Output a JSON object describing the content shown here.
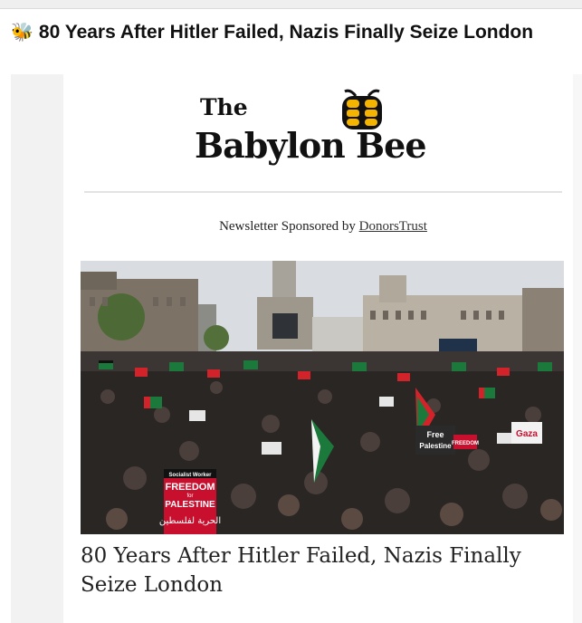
{
  "email": {
    "subject_icon": "bee-icon",
    "subject_emoji": "🐝",
    "subject": "80 Years After Hitler Failed, Nazis Finally Seize London"
  },
  "newsletter": {
    "logo_line1": "The",
    "logo_line2": "Babylon Bee",
    "logo_icon": "bee-logo-icon",
    "sponsor_prefix": "Newsletter Sponsored by",
    "sponsor_link": "DonorsTrust"
  },
  "article": {
    "image": {
      "sign_freedom_line1": "Socialist Worker",
      "sign_freedom_line2": "FREEDOM",
      "sign_freedom_line3": "for",
      "sign_freedom_line4": "PALESTINE",
      "sign_arabic": "الحرية لفلسطين",
      "sign_free_palestine_line1": "Free",
      "sign_free_palestine_line2": "Palestine",
      "sign_gaza": "Gaza",
      "sign_freedom_small": "FREEDOM"
    },
    "headline": "80 Years After Hitler Failed, Nazis Finally Seize London"
  },
  "colors": {
    "sign_red": "#c8102e",
    "flag_green": "#1b7a3b",
    "flag_red": "#d2232a",
    "crowd_dark": "#2a2624",
    "sky": "#d9dde2",
    "bee_yellow": "#f5b400"
  }
}
